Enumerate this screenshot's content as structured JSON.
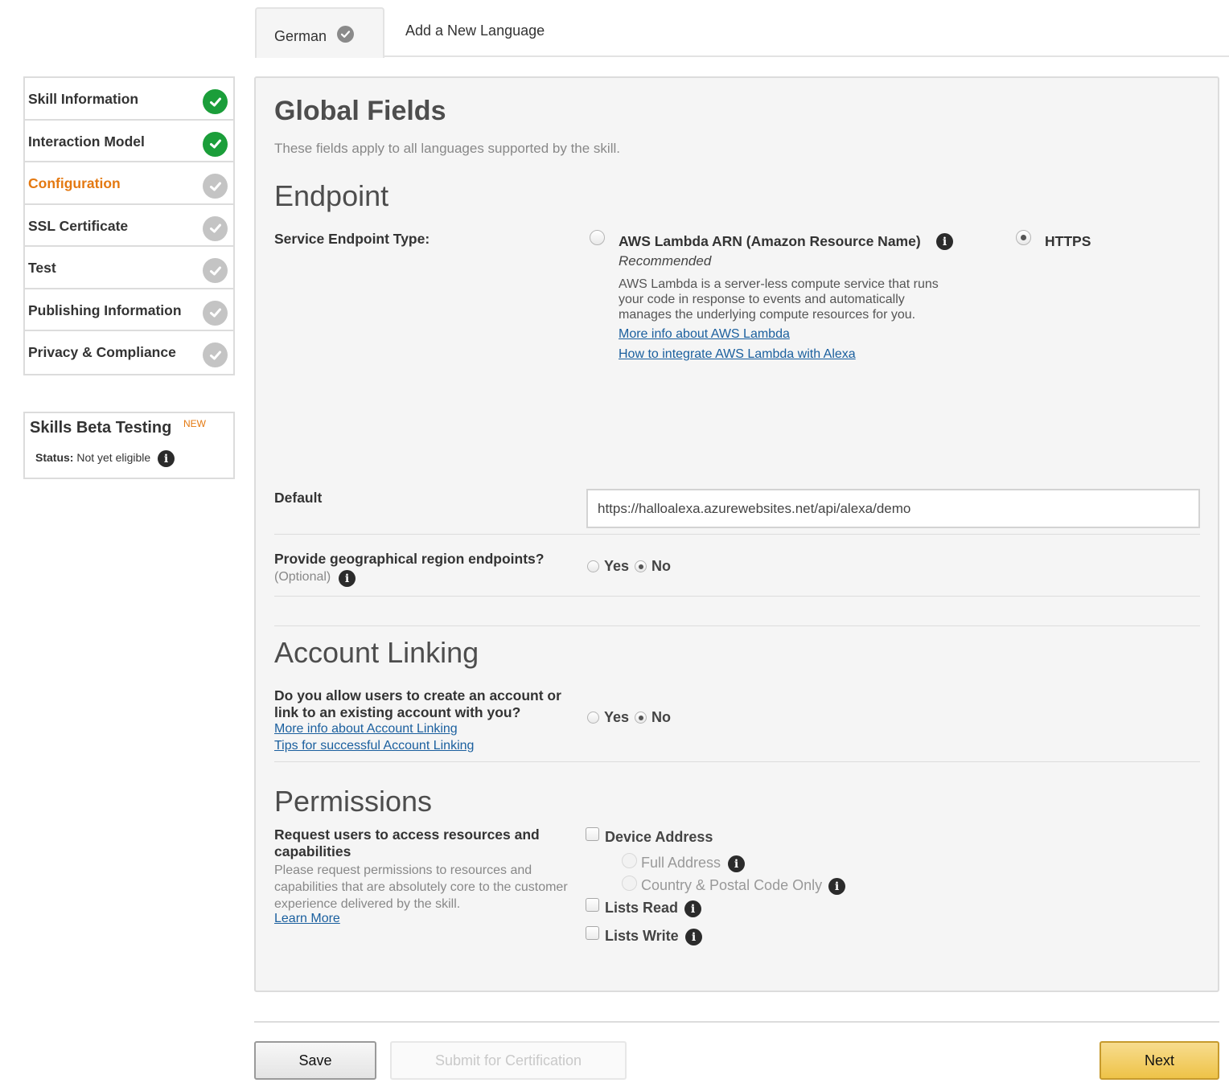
{
  "tabs": {
    "active_label": "German",
    "add_label": "Add a New Language"
  },
  "sidebar": {
    "items": [
      {
        "label": "Skill Information",
        "status": "complete"
      },
      {
        "label": "Interaction Model",
        "status": "complete"
      },
      {
        "label": "Configuration",
        "status": "current"
      },
      {
        "label": "SSL Certificate",
        "status": "pending"
      },
      {
        "label": "Test",
        "status": "pending"
      },
      {
        "label": "Publishing Information",
        "status": "pending"
      },
      {
        "label": "Privacy & Compliance",
        "status": "pending"
      }
    ],
    "beta": {
      "title": "Skills Beta Testing",
      "badge": "NEW",
      "status_label": "Status:",
      "status_value": "Not yet eligible"
    }
  },
  "main": {
    "title": "Global Fields",
    "subtitle": "These fields apply to all languages supported by the skill.",
    "endpoint": {
      "heading": "Endpoint",
      "type_label": "Service Endpoint Type:",
      "lambda_label": "AWS Lambda ARN (Amazon Resource Name)",
      "lambda_recommended": "Recommended",
      "lambda_desc_1": "AWS Lambda is a server-less compute service that runs",
      "lambda_desc_2": "your code in response to events and automatically",
      "lambda_desc_3": "manages the underlying compute resources for you.",
      "lambda_link_1": "More info about AWS Lambda",
      "lambda_link_2": "How to integrate AWS Lambda with Alexa",
      "https_label": "HTTPS",
      "selected": "HTTPS",
      "default_label": "Default",
      "default_value": "https://halloalexa.azurewebsites.net/api/alexa/demo",
      "geo_label": "Provide geographical region endpoints?",
      "geo_optional": "(Optional)",
      "geo_yes": "Yes",
      "geo_no": "No",
      "geo_selected": "No"
    },
    "account_linking": {
      "heading": "Account Linking",
      "question_1": "Do you allow users to create an account or",
      "question_2": "link to an existing account with you?",
      "link_1": "More info about Account Linking",
      "link_2": "Tips for successful Account Linking",
      "yes": "Yes",
      "no": "No",
      "selected": "No"
    },
    "permissions": {
      "heading": "Permissions",
      "label_1": "Request users to access resources and",
      "label_2": "capabilities",
      "desc_1": "Please request permissions to resources and",
      "desc_2": "capabilities that are absolutely core to the customer",
      "desc_3": "experience delivered by the skill.",
      "learn_more": "Learn More",
      "device_address": "Device Address",
      "full_address": "Full Address",
      "country_postal": "Country & Postal Code Only",
      "lists_read": "Lists Read",
      "lists_write": "Lists Write"
    }
  },
  "footer": {
    "save": "Save",
    "submit": "Submit for Certification",
    "next": "Next"
  },
  "colors": {
    "accent_orange": "#e47911",
    "complete_green": "#1b9e3a",
    "pending_gray": "#c4c4c4",
    "link_blue": "#1a5f9e",
    "next_button": "#f0c14b"
  }
}
